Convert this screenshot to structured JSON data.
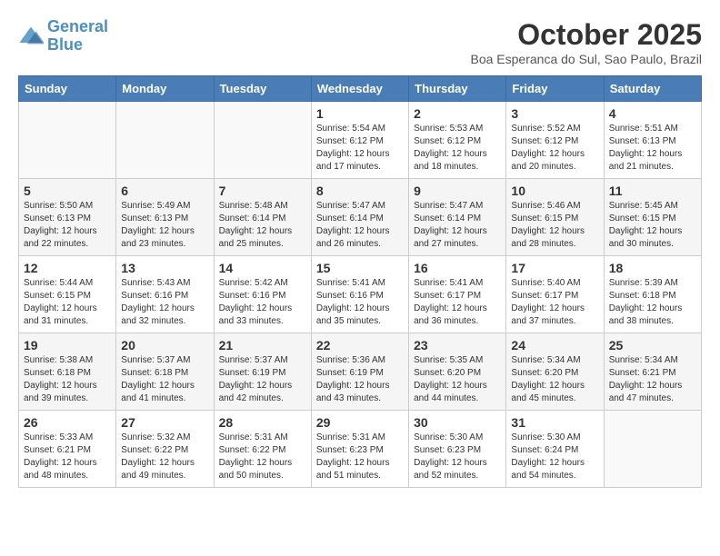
{
  "logo": {
    "line1": "General",
    "line2": "Blue"
  },
  "title": "October 2025",
  "location": "Boa Esperanca do Sul, Sao Paulo, Brazil",
  "days_of_week": [
    "Sunday",
    "Monday",
    "Tuesday",
    "Wednesday",
    "Thursday",
    "Friday",
    "Saturday"
  ],
  "weeks": [
    [
      {
        "day": "",
        "info": ""
      },
      {
        "day": "",
        "info": ""
      },
      {
        "day": "",
        "info": ""
      },
      {
        "day": "1",
        "info": "Sunrise: 5:54 AM\nSunset: 6:12 PM\nDaylight: 12 hours\nand 17 minutes."
      },
      {
        "day": "2",
        "info": "Sunrise: 5:53 AM\nSunset: 6:12 PM\nDaylight: 12 hours\nand 18 minutes."
      },
      {
        "day": "3",
        "info": "Sunrise: 5:52 AM\nSunset: 6:12 PM\nDaylight: 12 hours\nand 20 minutes."
      },
      {
        "day": "4",
        "info": "Sunrise: 5:51 AM\nSunset: 6:13 PM\nDaylight: 12 hours\nand 21 minutes."
      }
    ],
    [
      {
        "day": "5",
        "info": "Sunrise: 5:50 AM\nSunset: 6:13 PM\nDaylight: 12 hours\nand 22 minutes."
      },
      {
        "day": "6",
        "info": "Sunrise: 5:49 AM\nSunset: 6:13 PM\nDaylight: 12 hours\nand 23 minutes."
      },
      {
        "day": "7",
        "info": "Sunrise: 5:48 AM\nSunset: 6:14 PM\nDaylight: 12 hours\nand 25 minutes."
      },
      {
        "day": "8",
        "info": "Sunrise: 5:47 AM\nSunset: 6:14 PM\nDaylight: 12 hours\nand 26 minutes."
      },
      {
        "day": "9",
        "info": "Sunrise: 5:47 AM\nSunset: 6:14 PM\nDaylight: 12 hours\nand 27 minutes."
      },
      {
        "day": "10",
        "info": "Sunrise: 5:46 AM\nSunset: 6:15 PM\nDaylight: 12 hours\nand 28 minutes."
      },
      {
        "day": "11",
        "info": "Sunrise: 5:45 AM\nSunset: 6:15 PM\nDaylight: 12 hours\nand 30 minutes."
      }
    ],
    [
      {
        "day": "12",
        "info": "Sunrise: 5:44 AM\nSunset: 6:15 PM\nDaylight: 12 hours\nand 31 minutes."
      },
      {
        "day": "13",
        "info": "Sunrise: 5:43 AM\nSunset: 6:16 PM\nDaylight: 12 hours\nand 32 minutes."
      },
      {
        "day": "14",
        "info": "Sunrise: 5:42 AM\nSunset: 6:16 PM\nDaylight: 12 hours\nand 33 minutes."
      },
      {
        "day": "15",
        "info": "Sunrise: 5:41 AM\nSunset: 6:16 PM\nDaylight: 12 hours\nand 35 minutes."
      },
      {
        "day": "16",
        "info": "Sunrise: 5:41 AM\nSunset: 6:17 PM\nDaylight: 12 hours\nand 36 minutes."
      },
      {
        "day": "17",
        "info": "Sunrise: 5:40 AM\nSunset: 6:17 PM\nDaylight: 12 hours\nand 37 minutes."
      },
      {
        "day": "18",
        "info": "Sunrise: 5:39 AM\nSunset: 6:18 PM\nDaylight: 12 hours\nand 38 minutes."
      }
    ],
    [
      {
        "day": "19",
        "info": "Sunrise: 5:38 AM\nSunset: 6:18 PM\nDaylight: 12 hours\nand 39 minutes."
      },
      {
        "day": "20",
        "info": "Sunrise: 5:37 AM\nSunset: 6:18 PM\nDaylight: 12 hours\nand 41 minutes."
      },
      {
        "day": "21",
        "info": "Sunrise: 5:37 AM\nSunset: 6:19 PM\nDaylight: 12 hours\nand 42 minutes."
      },
      {
        "day": "22",
        "info": "Sunrise: 5:36 AM\nSunset: 6:19 PM\nDaylight: 12 hours\nand 43 minutes."
      },
      {
        "day": "23",
        "info": "Sunrise: 5:35 AM\nSunset: 6:20 PM\nDaylight: 12 hours\nand 44 minutes."
      },
      {
        "day": "24",
        "info": "Sunrise: 5:34 AM\nSunset: 6:20 PM\nDaylight: 12 hours\nand 45 minutes."
      },
      {
        "day": "25",
        "info": "Sunrise: 5:34 AM\nSunset: 6:21 PM\nDaylight: 12 hours\nand 47 minutes."
      }
    ],
    [
      {
        "day": "26",
        "info": "Sunrise: 5:33 AM\nSunset: 6:21 PM\nDaylight: 12 hours\nand 48 minutes."
      },
      {
        "day": "27",
        "info": "Sunrise: 5:32 AM\nSunset: 6:22 PM\nDaylight: 12 hours\nand 49 minutes."
      },
      {
        "day": "28",
        "info": "Sunrise: 5:31 AM\nSunset: 6:22 PM\nDaylight: 12 hours\nand 50 minutes."
      },
      {
        "day": "29",
        "info": "Sunrise: 5:31 AM\nSunset: 6:23 PM\nDaylight: 12 hours\nand 51 minutes."
      },
      {
        "day": "30",
        "info": "Sunrise: 5:30 AM\nSunset: 6:23 PM\nDaylight: 12 hours\nand 52 minutes."
      },
      {
        "day": "31",
        "info": "Sunrise: 5:30 AM\nSunset: 6:24 PM\nDaylight: 12 hours\nand 54 minutes."
      },
      {
        "day": "",
        "info": ""
      }
    ]
  ]
}
